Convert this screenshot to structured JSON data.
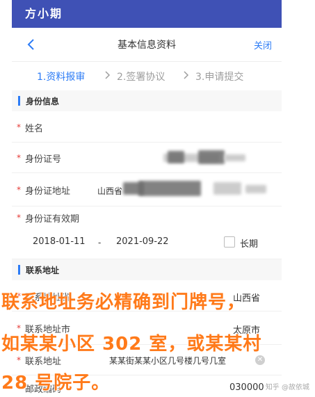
{
  "app": {
    "title": "方小期"
  },
  "nav": {
    "back_icon": "back-arrow-icon",
    "title": "基本信息资料",
    "close_label": "关闭"
  },
  "steps": [
    {
      "label": "1.资料报审",
      "active": true
    },
    {
      "label": "2.签署协议",
      "active": false
    },
    {
      "label": "3.申请提交",
      "active": false
    }
  ],
  "sections": {
    "identity": "身份信息",
    "contact": "联系地址"
  },
  "identity": {
    "name_label": "姓名",
    "id_number_label": "身份证号",
    "id_address_label": "身份证地址",
    "id_address_value_prefix": "山西省",
    "validity_label": "身份证有效期",
    "validity_start": "2018-01-11",
    "validity_separator": "-",
    "validity_end": "2021-09-22",
    "long_term_label": "长期"
  },
  "contact": {
    "province_label": "联系地址省",
    "province_value": "山西省",
    "city_label": "联系地址市",
    "city_value": "太原市",
    "address_label": "联系地址",
    "address_value": "某某街某某小区几号楼几号几室",
    "postcode_label": "邮政编码",
    "postcode_value": "030000"
  },
  "required_mark": "*",
  "overlay": {
    "line1": "联系地址务必精确到门牌号，",
    "line2": "如某某小区 302 室，或某某村",
    "line3": "28 号院子。"
  },
  "watermark": "知乎 @故依城",
  "colors": {
    "primary": "#3f51b5",
    "accent": "#2d7cf6",
    "overlay_text": "#ff7a1a",
    "required": "#e53935"
  }
}
